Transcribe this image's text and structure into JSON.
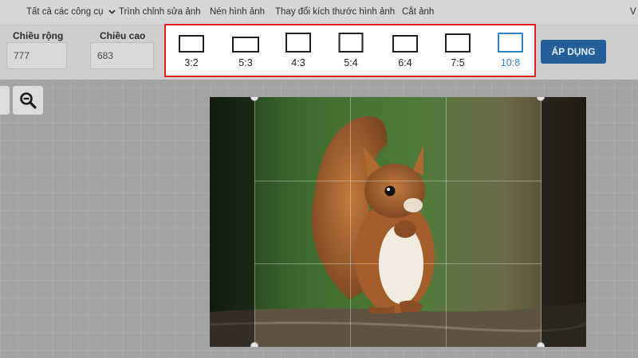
{
  "nav": {
    "all_tools": "Tất cả các công cụ",
    "photo_editor": "Trình chỉnh sửa ảnh",
    "compress": "Nén hình ảnh",
    "resize": "Thay đổi kích thước hình ảnh",
    "crop": "Cắt ảnh",
    "cut_off": "V"
  },
  "toolbar": {
    "width_label": "Chiều rộng",
    "width_value": "777",
    "height_label": "Chiều cao",
    "height_value": "683",
    "apply_label": "ÁP DỤNG"
  },
  "ratios": [
    {
      "label": "3:2",
      "selected": false
    },
    {
      "label": "5:3",
      "selected": false
    },
    {
      "label": "4:3",
      "selected": false
    },
    {
      "label": "5:4",
      "selected": false
    },
    {
      "label": "6:4",
      "selected": false
    },
    {
      "label": "7:5",
      "selected": false
    },
    {
      "label": "10:8",
      "selected": true
    }
  ],
  "colors": {
    "accent": "#2e86c7",
    "apply_button": "#255f99",
    "highlight_border": "#e0201d"
  },
  "icons": {
    "zoom_out": "zoom-out-icon",
    "chevron": "chevron-down-icon"
  },
  "image": {
    "subject": "red squirrel photo being cropped"
  }
}
